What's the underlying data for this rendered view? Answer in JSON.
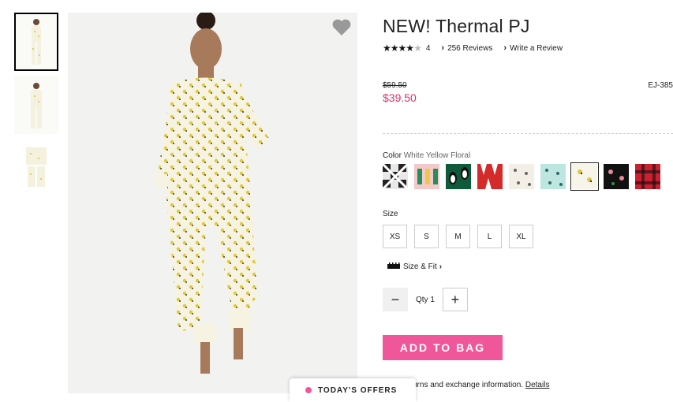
{
  "product": {
    "title": "NEW! Thermal PJ",
    "rating_count": "4",
    "reviews_link": "256 Reviews",
    "write_review": "Write a Review",
    "old_price": "$59.50",
    "price": "$39.50",
    "sku": "EJ-385",
    "color_label": "Color",
    "color_value": "White Yellow Floral",
    "size_label": "Size",
    "sizes": [
      "XS",
      "S",
      "M",
      "L",
      "XL"
    ],
    "size_fit": "Size & Fit",
    "qty_label": "Qty 1",
    "add_to_bag": "ADD TO BAG",
    "returns_text": "urns and exchange information.",
    "details_link": "Details",
    "offers_label": "TODAY'S OFFERS"
  },
  "rating_value": 4,
  "rating_max": 5,
  "swatches": [
    {
      "name": "buffalo-check-white"
    },
    {
      "name": "nutcracker-pink"
    },
    {
      "name": "penguin-green"
    },
    {
      "name": "red-white-pattern"
    },
    {
      "name": "cream-print"
    },
    {
      "name": "mint-print"
    },
    {
      "name": "white-yellow-floral",
      "selected": true
    },
    {
      "name": "black-floral"
    },
    {
      "name": "red-plaid"
    }
  ],
  "colors": {
    "accent": "#f0579a",
    "price": "#d6336c"
  },
  "icons": [
    "heart-icon",
    "chevron-right-icon",
    "ruler-icon",
    "minus-icon",
    "plus-icon",
    "star-icon"
  ]
}
